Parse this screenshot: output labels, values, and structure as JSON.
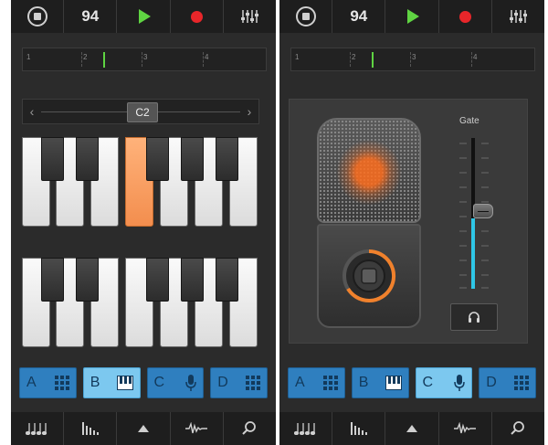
{
  "topbar": {
    "tempo": "94",
    "stop_icon": "stop-circle-icon",
    "play_icon": "play-icon",
    "record_icon": "record-icon",
    "mixer_icon": "mixer-icon"
  },
  "ruler": {
    "bars": [
      "1",
      "2",
      "3",
      "4"
    ]
  },
  "keyboard": {
    "octave_label": "C2",
    "left_arrow": "‹",
    "right_arrow": "›",
    "pressed_key": "D2"
  },
  "mic": {
    "gate_label": "Gate",
    "gate_level": 0.47
  },
  "tracks": [
    {
      "letter": "A",
      "icon": "drum-grid-icon"
    },
    {
      "letter": "B",
      "icon": "keyboard-icon"
    },
    {
      "letter": "C",
      "icon": "microphone-icon"
    },
    {
      "letter": "D",
      "icon": "drum-grid-icon"
    }
  ],
  "left_active_track": "B",
  "right_active_track": "C",
  "bottombar": [
    "notes-icon",
    "levels-icon",
    "up-arrow-icon",
    "waveform-icon",
    "search-icon"
  ],
  "colors": {
    "track_blue": "#2f7fbf",
    "track_active": "#7cc8ef",
    "play_green": "#5fd442",
    "record_red": "#e8262a",
    "key_pressed": "#f38e4e",
    "gate_cyan": "#2ec6e6"
  }
}
